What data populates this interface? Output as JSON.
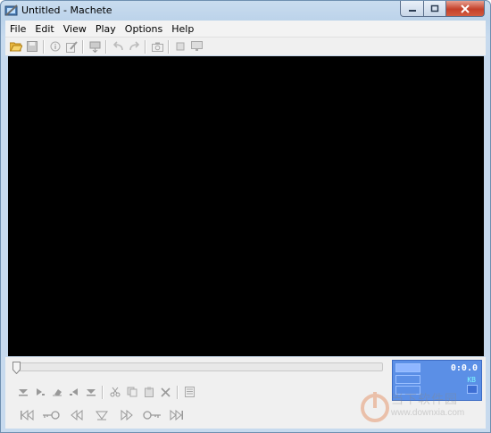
{
  "window": {
    "title": "Untitled - Machete"
  },
  "menu": [
    "File",
    "Edit",
    "View",
    "Play",
    "Options",
    "Help"
  ],
  "toolbar": {
    "icons": [
      "open-icon",
      "save-icon",
      "info-icon",
      "edit-tags-icon",
      "export-icon",
      "undo-icon",
      "redo-icon",
      "snapshot-icon",
      "crop-icon",
      "fullscreen-icon"
    ]
  },
  "playback": {
    "position_fraction": 0.0,
    "time": "0:0.0",
    "size_unit": "KB"
  },
  "watermark": {
    "cn": "当下软件园",
    "url": "www.downxia.com"
  },
  "colors": {
    "counter_bg": "#5b8fe6",
    "video_bg": "#000000",
    "accent": "#3d6cc4"
  }
}
